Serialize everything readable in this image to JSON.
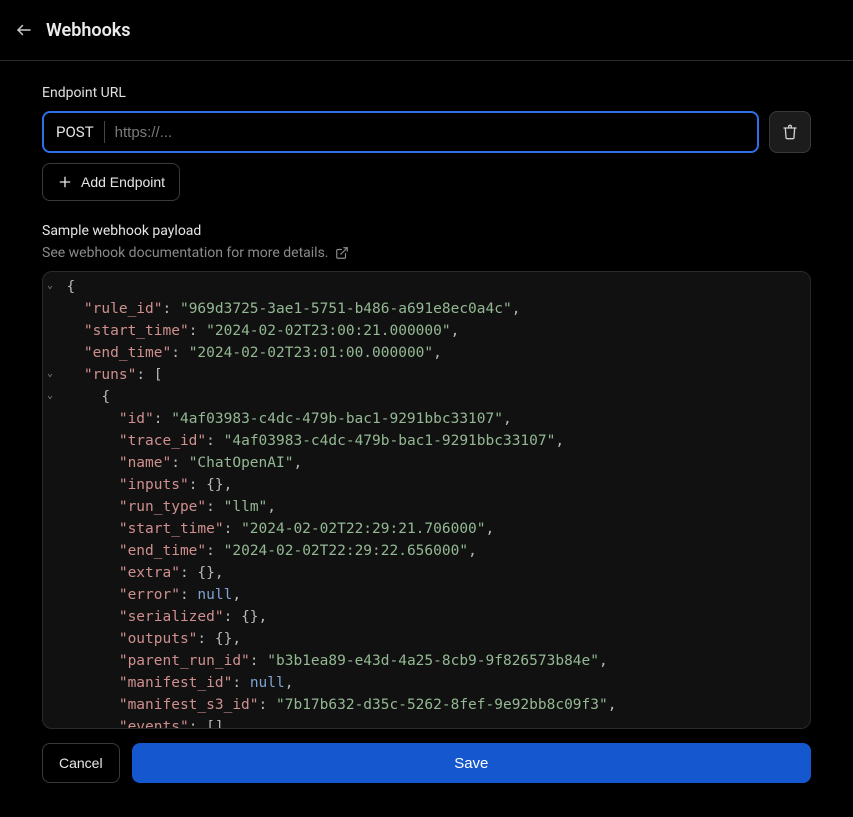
{
  "header": {
    "title": "Webhooks"
  },
  "endpoint": {
    "label": "Endpoint URL",
    "method": "POST",
    "placeholder": "https://...",
    "value": "",
    "addLabel": "Add Endpoint"
  },
  "sample": {
    "title": "Sample webhook payload",
    "docText": "See webhook documentation for more details."
  },
  "payload": {
    "rule_id": "969d3725-3ae1-5751-b486-a691e8ec0a4c",
    "start_time": "2024-02-02T23:00:21.000000",
    "end_time": "2024-02-02T23:01:00.000000",
    "runs": [
      {
        "id": "4af03983-c4dc-479b-bac1-9291bbc33107",
        "trace_id": "4af03983-c4dc-479b-bac1-9291bbc33107",
        "name": "ChatOpenAI",
        "inputs": "{}",
        "run_type": "llm",
        "start_time": "2024-02-02T22:29:21.706000",
        "end_time": "2024-02-02T22:29:22.656000",
        "extra": "{}",
        "error": null,
        "serialized": "{}",
        "outputs": "{}",
        "parent_run_id": "b3b1ea89-e43d-4a25-8cb9-9f826573b84e",
        "manifest_id": null,
        "manifest_s3_id": "7b17b632-d35c-5262-8fef-9e92bb8c09f3",
        "events": "[]"
      }
    ]
  },
  "actions": {
    "cancel": "Cancel",
    "save": "Save"
  }
}
